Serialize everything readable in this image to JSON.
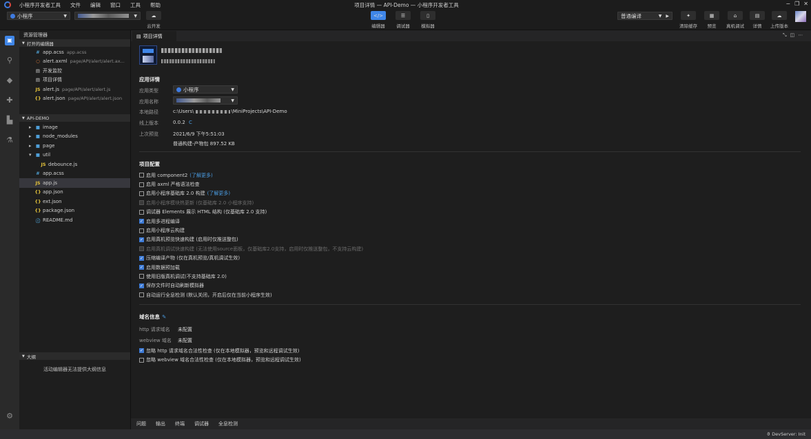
{
  "titlebar": {
    "app_name": "小程序开发者工具",
    "menu": [
      "文件",
      "编辑",
      "窗口",
      "工具",
      "帮助"
    ],
    "window_title": "项目详情 — API-Demo — 小程序开发者工具"
  },
  "toolbar": {
    "mode_select": "小程序",
    "cloud_label": "云开发",
    "views": [
      {
        "label": "编辑器",
        "icon": "code-icon",
        "active": true
      },
      {
        "label": "调试器",
        "icon": "sliders-icon",
        "active": false
      },
      {
        "label": "模拟器",
        "icon": "phone-icon",
        "active": false
      }
    ],
    "compile_select": "普通编译",
    "actions": [
      {
        "label": "清除缓存",
        "icon": "broom-icon"
      },
      {
        "label": "预览",
        "icon": "preview-icon"
      },
      {
        "label": "真机调试",
        "icon": "device-debug-icon"
      },
      {
        "label": "详情",
        "icon": "details-icon"
      },
      {
        "label": "上传版本",
        "icon": "cloud-upload-icon"
      }
    ]
  },
  "explorer": {
    "title": "资源管理器",
    "open_editors_title": "打开的编辑器",
    "open_editors": [
      {
        "icon": "#",
        "name": "app.acss",
        "path": "app.acss",
        "color": "#4fa3d6"
      },
      {
        "icon": "○",
        "name": "alert.axml",
        "path": "page/API/alert/alert.ax...",
        "color": "#e07b39"
      },
      {
        "icon": "▤",
        "name": "开发监控",
        "path": "",
        "color": "#cfcfcf"
      },
      {
        "icon": "▤",
        "name": "项目详情",
        "path": "",
        "color": "#cfcfcf"
      },
      {
        "icon": "JS",
        "name": "alert.js",
        "path": "page/API/alert/alert.js",
        "color": "#e5c33b"
      },
      {
        "icon": "{}",
        "name": "alert.json",
        "path": "page/API/alert/alert.json",
        "color": "#e5c33b"
      }
    ],
    "project_title": "API-DEMO",
    "tree": [
      {
        "type": "folder",
        "name": "image",
        "depth": 0,
        "open": false
      },
      {
        "type": "folder",
        "name": "node_modules",
        "depth": 0,
        "open": false
      },
      {
        "type": "folder",
        "name": "page",
        "depth": 0,
        "open": false
      },
      {
        "type": "folder",
        "name": "util",
        "depth": 0,
        "open": true
      },
      {
        "type": "file",
        "icon": "JS",
        "name": "debounce.js",
        "depth": 1,
        "color": "#e5c33b"
      },
      {
        "type": "file",
        "icon": "#",
        "name": "app.acss",
        "depth": 0,
        "color": "#4fa3d6"
      },
      {
        "type": "file",
        "icon": "JS",
        "name": "app.js",
        "depth": 0,
        "color": "#e5c33b",
        "selected": true
      },
      {
        "type": "file",
        "icon": "{}",
        "name": "app.json",
        "depth": 0,
        "color": "#e5c33b"
      },
      {
        "type": "file",
        "icon": "{}",
        "name": "ext.json",
        "depth": 0,
        "color": "#e5c33b"
      },
      {
        "type": "file",
        "icon": "{}",
        "name": "package.json",
        "depth": 0,
        "color": "#e5c33b"
      },
      {
        "type": "file",
        "icon": "ⓘ",
        "name": "README.md",
        "depth": 0,
        "color": "#4fa3d6"
      }
    ],
    "outline_title": "大纲",
    "outline_empty": "活动编辑器无法提供大纲信息"
  },
  "tab": {
    "label": "项目详情"
  },
  "details": {
    "app_section": "应用详情",
    "type_label": "应用类型",
    "type_value": "小程序",
    "name_label": "应用名称",
    "path_label": "本地路径",
    "path_value_prefix": "c:\\Users\\",
    "path_value_suffix": "\\MiniProjects\\API-Demo",
    "version_label": "线上版本",
    "version_value": "0.0.2",
    "preview_label": "上次预览",
    "preview_time": "2021/6/9 下午5:51:03",
    "preview_build": "普通构建-产物包 897.52 KB",
    "config_section": "项目配置",
    "options": [
      {
        "text": "启用 component2",
        "link": "(了解更多)",
        "checked": false,
        "disabled": false
      },
      {
        "text": "启用 axml 严格语法检查",
        "link": "",
        "checked": false,
        "disabled": false
      },
      {
        "text": "启用小程序基础库 2.0 构建",
        "link": "(了解更多)",
        "checked": false,
        "disabled": false
      },
      {
        "text": "启用小程序模块热更新 (仅基础库 2.0 小程序支持)",
        "link": "",
        "checked": false,
        "disabled": true
      },
      {
        "text": "调试器 Elements 展示 HTML 结构 (仅基础库 2.0 支持)",
        "link": "",
        "checked": false,
        "disabled": false
      },
      {
        "text": "启用多进程编译",
        "link": "",
        "checked": true,
        "disabled": false
      },
      {
        "text": "启用小程序云构建",
        "link": "",
        "checked": false,
        "disabled": false
      },
      {
        "text": "启用真机预览快速构建 (启用时仅推送整包)",
        "link": "",
        "checked": true,
        "disabled": false
      },
      {
        "text": "启用真机调试快速构建 (无法使用source面板，仅基础库2.0支持，启用时仅推送整包，不支持云构建)",
        "link": "",
        "checked": false,
        "disabled": true
      },
      {
        "text": "压缩编译产物 (仅在真机预览/真机调试生效)",
        "link": "",
        "checked": true,
        "disabled": false
      },
      {
        "text": "启用数据预加载",
        "link": "",
        "checked": true,
        "disabled": false
      },
      {
        "text": "使用旧版真机调试(不支持基础库 2.0)",
        "link": "",
        "checked": false,
        "disabled": false
      },
      {
        "text": "保存文件时自动刷新模拟器",
        "link": "",
        "checked": true,
        "disabled": false
      },
      {
        "text": "自动运行全息检测 (默认关闭，开启后仅在当前小程序生效)",
        "link": "",
        "checked": false,
        "disabled": false
      }
    ],
    "domain_section": "域名信息",
    "http_label": "http 请求域名",
    "http_value": "未配置",
    "webview_label": "webview 域名",
    "webview_value": "未配置",
    "domain_options": [
      {
        "text": "忽略 http 请求域名合法性检查 (仅在本地模拟器，预览和远程调试生效)",
        "checked": true
      },
      {
        "text": "忽略 webview 域名合法性检查 (仅在本地模拟器，预览和远程调试生效)",
        "checked": false
      }
    ]
  },
  "bottom_tabs": [
    "问题",
    "输出",
    "终端",
    "调试器",
    "全息检测"
  ],
  "status": {
    "right": "DevServer: Init"
  }
}
